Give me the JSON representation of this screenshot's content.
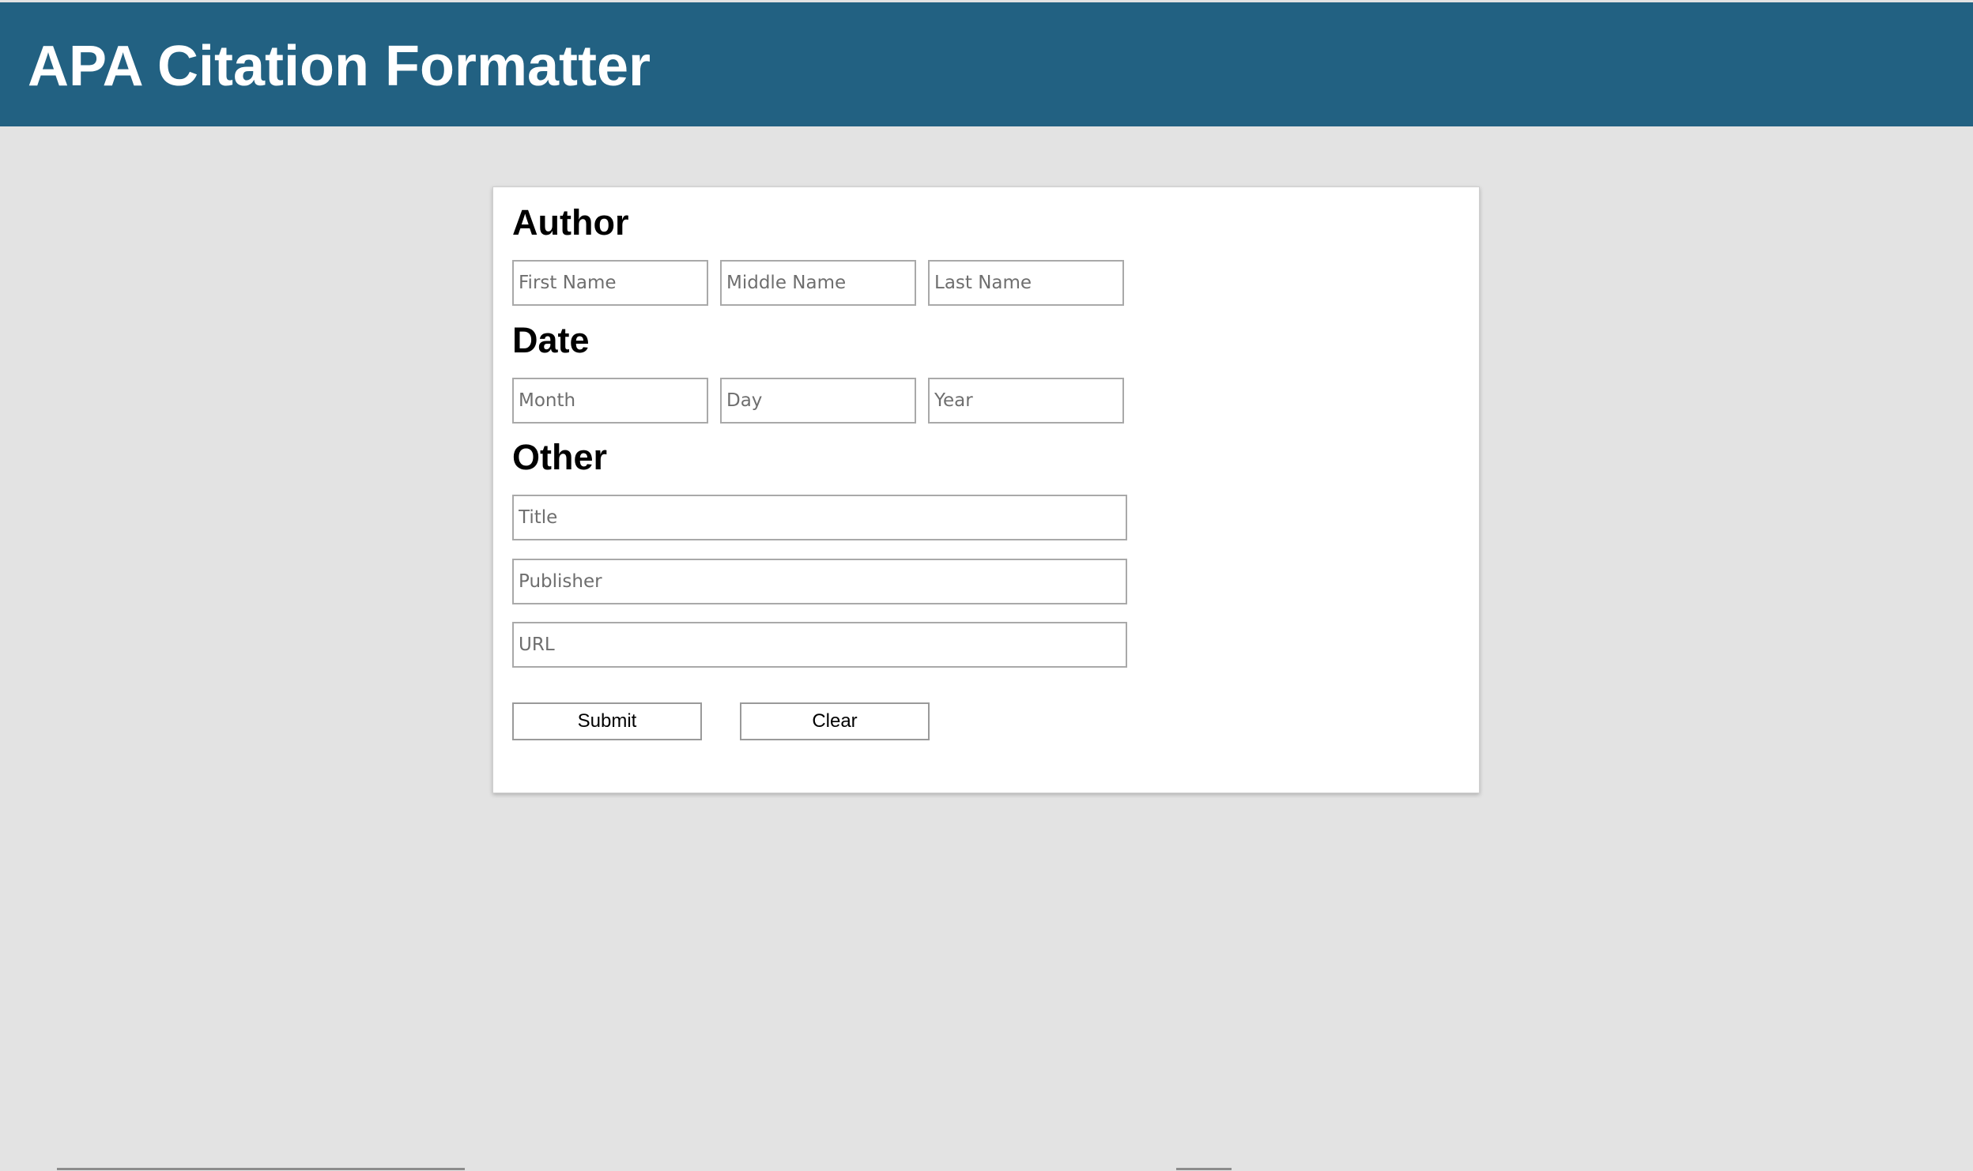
{
  "header": {
    "title": "APA Citation Formatter"
  },
  "form": {
    "author": {
      "heading": "Author",
      "first_name_placeholder": "First Name",
      "middle_name_placeholder": "Middle Name",
      "last_name_placeholder": "Last Name"
    },
    "date": {
      "heading": "Date",
      "month_placeholder": "Month",
      "day_placeholder": "Day",
      "year_placeholder": "Year"
    },
    "other": {
      "heading": "Other",
      "title_placeholder": "Title",
      "publisher_placeholder": "Publisher",
      "url_placeholder": "URL"
    },
    "buttons": {
      "submit_label": "Submit",
      "clear_label": "Clear"
    }
  },
  "colors": {
    "header_background": "#226182",
    "page_background": "#e3e3e3",
    "card_background": "#ffffff"
  }
}
